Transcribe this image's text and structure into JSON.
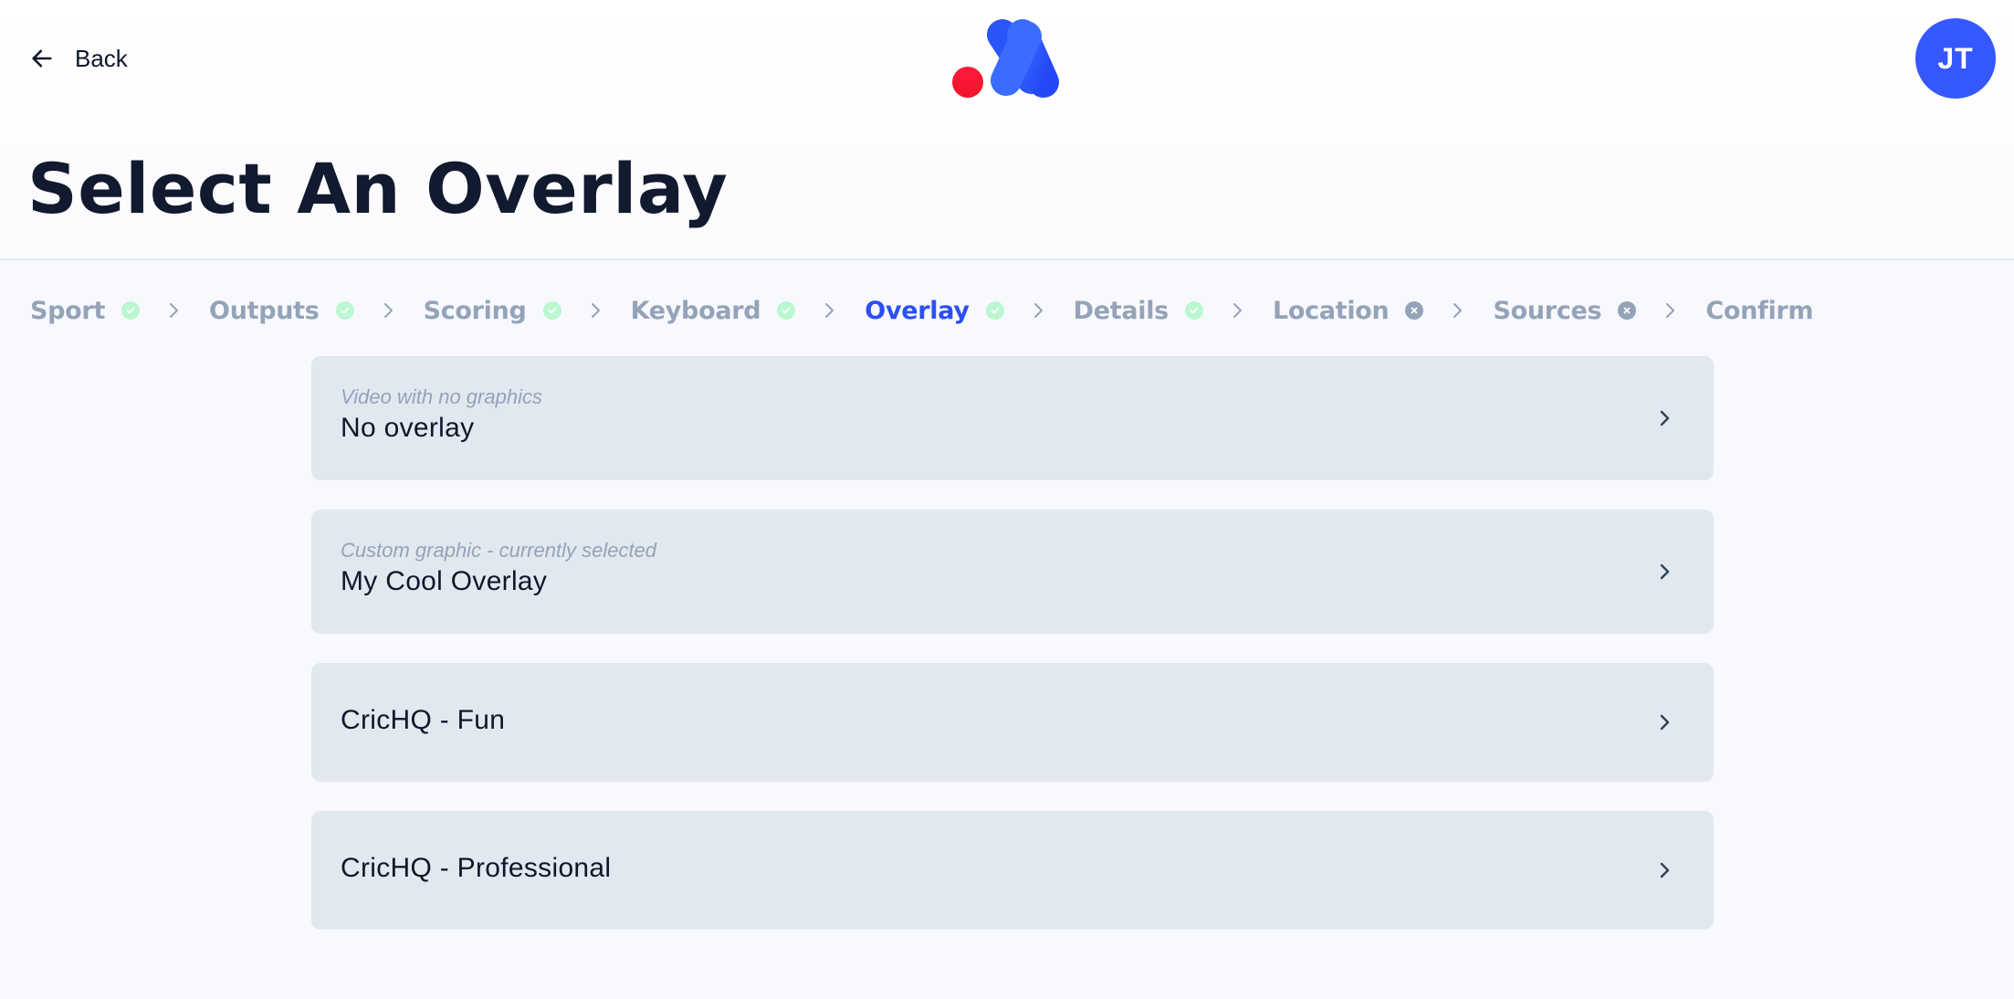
{
  "header": {
    "back_label": "Back",
    "avatar_initials": "JT",
    "page_title": "Select An Overlay"
  },
  "colors": {
    "accent": "#2c4ef5",
    "avatar_bg": "#3558fe",
    "logo_dot": "#f5132f",
    "step_done": "#bbf7d0",
    "step_error": "#94a3b8",
    "card_bg": "#e2e8f0"
  },
  "steps": [
    {
      "label": "Sport",
      "status": "complete",
      "icon": "check-circle-icon"
    },
    {
      "label": "Outputs",
      "status": "complete",
      "icon": "check-circle-icon"
    },
    {
      "label": "Scoring",
      "status": "complete",
      "icon": "check-circle-icon"
    },
    {
      "label": "Keyboard",
      "status": "complete",
      "icon": "check-circle-icon"
    },
    {
      "label": "Overlay",
      "status": "complete",
      "icon": "check-circle-icon",
      "active": true
    },
    {
      "label": "Details",
      "status": "complete",
      "icon": "check-circle-icon"
    },
    {
      "label": "Location",
      "status": "incomplete",
      "icon": "x-circle-icon"
    },
    {
      "label": "Sources",
      "status": "incomplete",
      "icon": "x-circle-icon"
    },
    {
      "label": "Confirm",
      "status": "none",
      "icon": null
    }
  ],
  "options": [
    {
      "subtitle": "Video with no graphics",
      "title": "No overlay"
    },
    {
      "subtitle": "Custom graphic - currently selected",
      "title": "My Cool Overlay"
    },
    {
      "subtitle": "",
      "title": "CricHQ - Fun"
    },
    {
      "subtitle": "",
      "title": "CricHQ - Professional"
    }
  ]
}
